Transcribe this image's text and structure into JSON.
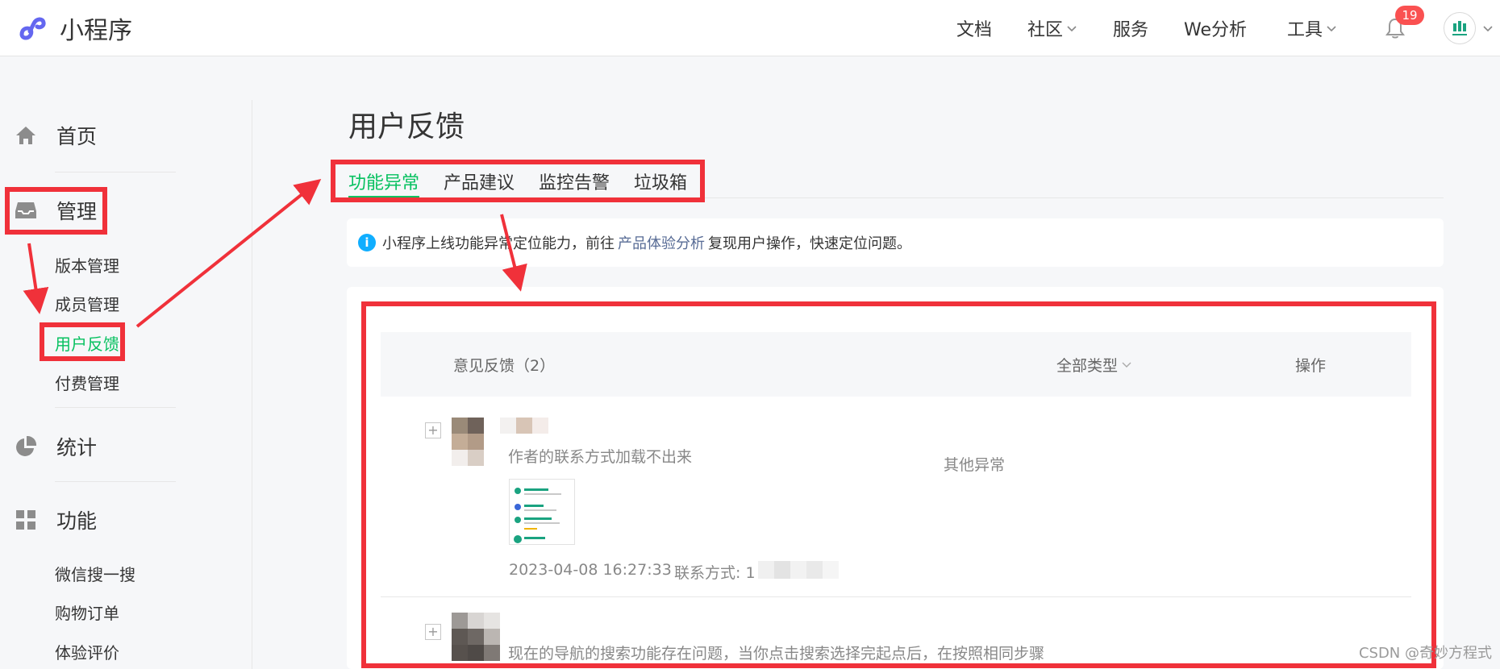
{
  "brand": {
    "name": "小程序",
    "color": "#6467f0"
  },
  "topnav": {
    "items": [
      {
        "label": "文档",
        "has_dropdown": false
      },
      {
        "label": "社区",
        "has_dropdown": true
      },
      {
        "label": "服务",
        "has_dropdown": false
      },
      {
        "label": "We分析",
        "has_dropdown": false
      },
      {
        "label": "工具",
        "has_dropdown": true
      }
    ],
    "notification_count": "19",
    "avatar_icon": "app-avatar-icon"
  },
  "sidebar": {
    "home": {
      "label": "首页",
      "icon": "home-icon"
    },
    "manage": {
      "label": "管理",
      "icon": "inbox-icon",
      "items": [
        "版本管理",
        "成员管理",
        "用户反馈",
        "付费管理"
      ],
      "active_item": "用户反馈"
    },
    "stats": {
      "label": "统计",
      "icon": "pie-chart-icon"
    },
    "features": {
      "label": "功能",
      "icon": "grid-icon",
      "items": [
        "微信搜一搜",
        "购物订单",
        "体验评价"
      ]
    }
  },
  "main": {
    "title": "用户反馈",
    "tabs": [
      "功能异常",
      "产品建议",
      "监控告警",
      "垃圾箱"
    ],
    "active_tab": "功能异常",
    "notice": {
      "text_before": "小程序上线功能异常定位能力，前往",
      "link": "产品体验分析",
      "text_after": "复现用户操作，快速定位问题。"
    },
    "table": {
      "headers": {
        "feedback": "意见反馈（2）",
        "type": "全部类型",
        "action": "操作"
      },
      "rows": [
        {
          "text": "作者的联系方式加载不出来",
          "type": "其他异常",
          "time": "2023-04-08 16:27:33",
          "contact_label": "联系方式: 1",
          "has_screenshot": true
        },
        {
          "text": "现在的导航的搜索功能存在问题，当你点击搜索选择完起点后，在按照相同步骤",
          "type": "",
          "time": "",
          "contact_label": "",
          "has_screenshot": false
        }
      ]
    }
  },
  "watermark": "CSDN @奇妙方程式",
  "colors": {
    "accent": "#07c160",
    "highlight": "#f0313a",
    "link": "#576b95",
    "badge": "#fa5151"
  }
}
